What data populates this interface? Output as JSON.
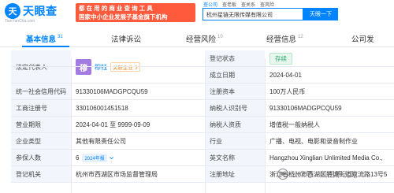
{
  "header": {
    "logo_mark": "天",
    "logo_text": "天眼查",
    "logo_sub": "TianYanCha.com",
    "slogan_line1": "都 在 用 的 商 业 查 询 工 具",
    "slogan_line2": "国家中小企业发展子基金旗下机构",
    "search_tabs": [
      "查公司",
      "查老板",
      "查关系",
      "查风险"
    ],
    "search_value": "杭州星链无限传媒有限公司",
    "search_button": "天眼一下"
  },
  "nav": {
    "tabs": [
      {
        "label": "基本信息",
        "count": "31"
      },
      {
        "label": "法律诉讼",
        "count": ""
      },
      {
        "label": "经营风险",
        "count": "10"
      },
      {
        "label": "经营信息",
        "count": "12"
      },
      {
        "label": "公司发",
        "count": ""
      }
    ]
  },
  "info": {
    "rows": [
      {
        "l1": "法定代表人",
        "l2": "登记状态",
        "v2": "存续"
      },
      {
        "l1": "",
        "l2": "成立日期",
        "v2": "2024-04-01"
      },
      {
        "l1": "统一社会信用代码",
        "v1": "91330106MADGPCQU59",
        "l2": "注册资本",
        "v2": "100万人民币"
      },
      {
        "l1": "工商注册号",
        "v1": "330106001451518",
        "l2": "纳税人识别号",
        "v2": "91330106MADGPCQU59"
      },
      {
        "l1": "营业期限",
        "v1": "2024-04-01 至 9999-09-09",
        "l2": "纳税人资质",
        "v2": "增值税一般纳税人"
      },
      {
        "l1": "企业类型",
        "v1": "其他有限责任公司",
        "l2": "行业",
        "v2": "广播、电视、电影和录音制作业"
      },
      {
        "l1": "参保人数",
        "v1": "6",
        "l2": "英文名称",
        "v2": "Hangzhou Xinglian Unlimited Media Co.,"
      },
      {
        "l1": "登记机关",
        "v1": "杭州市西湖区市场监督管理局",
        "l2": "注册地址",
        "v2": "浙江省杭州市西湖区转塘街道双流路13号5"
      }
    ],
    "rep_logo": "穆",
    "rep_name": "穆钰",
    "rep_tag": "关联企业",
    "rep_tag_count": "3",
    "year_tag": "2024年报"
  },
  "watermark": {
    "text": "公众号 · 瓜田不说路"
  }
}
